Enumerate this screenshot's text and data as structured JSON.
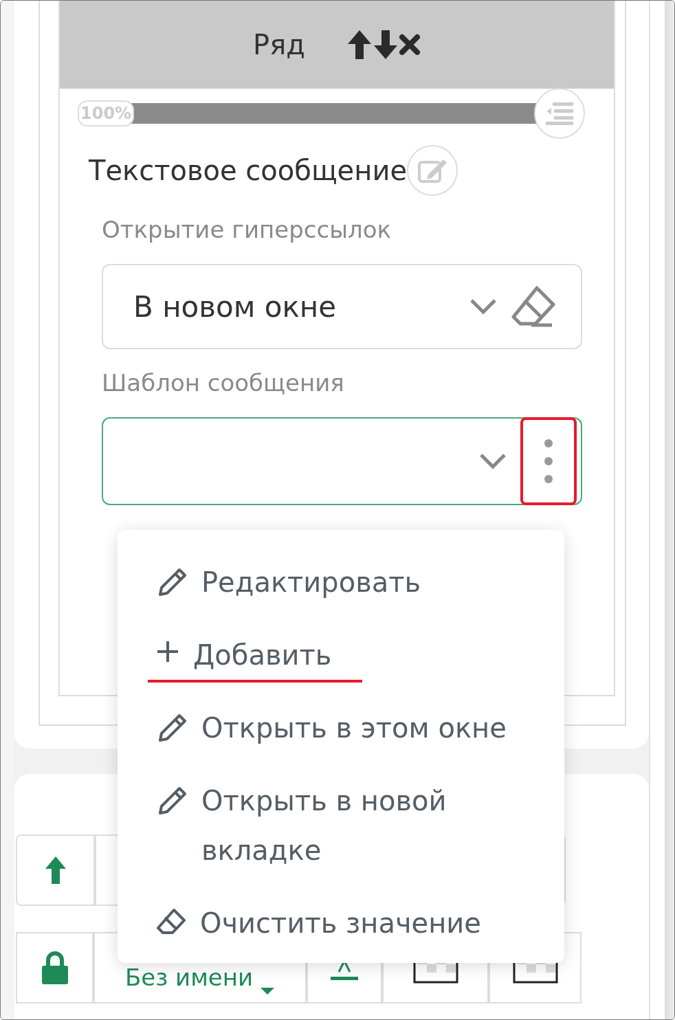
{
  "panel": {
    "title": "Ряд",
    "progress": {
      "label": "100%",
      "level": 1
    },
    "section_title": "Текстовое сообщение",
    "fields": [
      {
        "label": "Открытие гиперссылок",
        "value": "В новом окне",
        "kind": "clearable",
        "focused": false
      },
      {
        "label": "Шаблон сообщения",
        "kind": "menu",
        "focused": true,
        "highlighted": true
      }
    ]
  },
  "menu": {
    "items": [
      {
        "kind": "pencil",
        "label": "Редактировать",
        "highlighted": false
      },
      {
        "kind": "plus",
        "label": "Добавить",
        "highlighted": true
      },
      {
        "kind": "pencil",
        "label": "Открыть в этом окне",
        "highlighted": false
      },
      {
        "kind": "pencil",
        "label": "Открыть в новой вкладке",
        "highlighted": false
      },
      {
        "kind": "eraser",
        "label": "Очистить значение",
        "highlighted": false
      }
    ]
  },
  "toolbar": {
    "style_name": "Без имени"
  }
}
